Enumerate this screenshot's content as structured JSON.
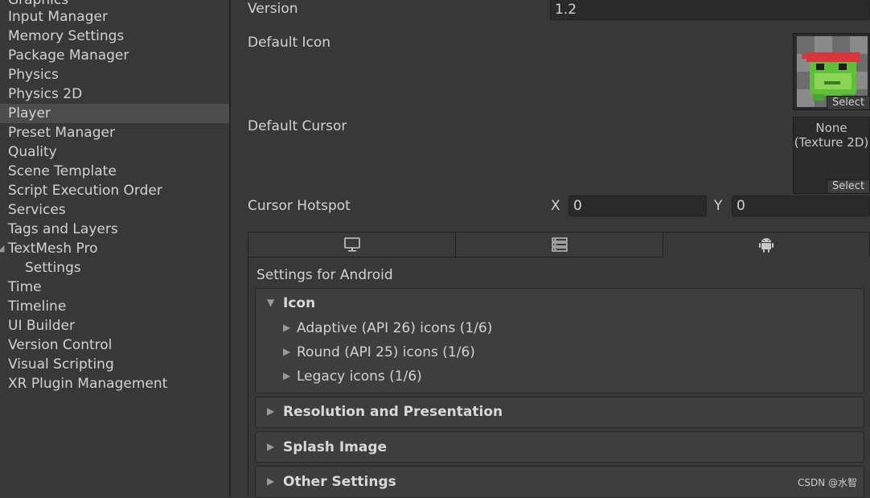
{
  "sidebar": {
    "items": [
      {
        "label": "Graphics"
      },
      {
        "label": "Input Manager"
      },
      {
        "label": "Memory Settings"
      },
      {
        "label": "Package Manager"
      },
      {
        "label": "Physics"
      },
      {
        "label": "Physics 2D"
      },
      {
        "label": "Player"
      },
      {
        "label": "Preset Manager"
      },
      {
        "label": "Quality"
      },
      {
        "label": "Scene Template"
      },
      {
        "label": "Script Execution Order"
      },
      {
        "label": "Services"
      },
      {
        "label": "Tags and Layers"
      },
      {
        "label": "TextMesh Pro"
      },
      {
        "label": "Settings"
      },
      {
        "label": "Time"
      },
      {
        "label": "Timeline"
      },
      {
        "label": "UI Builder"
      },
      {
        "label": "Version Control"
      },
      {
        "label": "Visual Scripting"
      },
      {
        "label": "XR Plugin Management"
      }
    ],
    "selected": "Player"
  },
  "player": {
    "version_label": "Version",
    "version_value": "1.2",
    "default_icon_label": "Default Icon",
    "icon_select": "Select",
    "default_cursor_label": "Default Cursor",
    "cursor_none_line1": "None",
    "cursor_none_line2": "(Texture 2D)",
    "cursor_select": "Select",
    "hotspot_label": "Cursor Hotspot",
    "hotspot_x_label": "X",
    "hotspot_x": "0",
    "hotspot_y_label": "Y",
    "hotspot_y": "0"
  },
  "platform_tabs": [
    {
      "icon": "monitor-icon",
      "active": false
    },
    {
      "icon": "server-icon",
      "active": false
    },
    {
      "icon": "android-icon",
      "active": true
    }
  ],
  "settings": {
    "title": "Settings for Android",
    "icon_group": {
      "label": "Icon",
      "expanded": true,
      "items": [
        {
          "label": "Adaptive (API 26) icons (1/6)"
        },
        {
          "label": "Round (API 25) icons (1/6)"
        },
        {
          "label": "Legacy icons (1/6)"
        }
      ]
    },
    "resolution_label": "Resolution and Presentation",
    "splash_label": "Splash Image",
    "other_label": "Other Settings"
  },
  "watermark": "CSDN @水智"
}
